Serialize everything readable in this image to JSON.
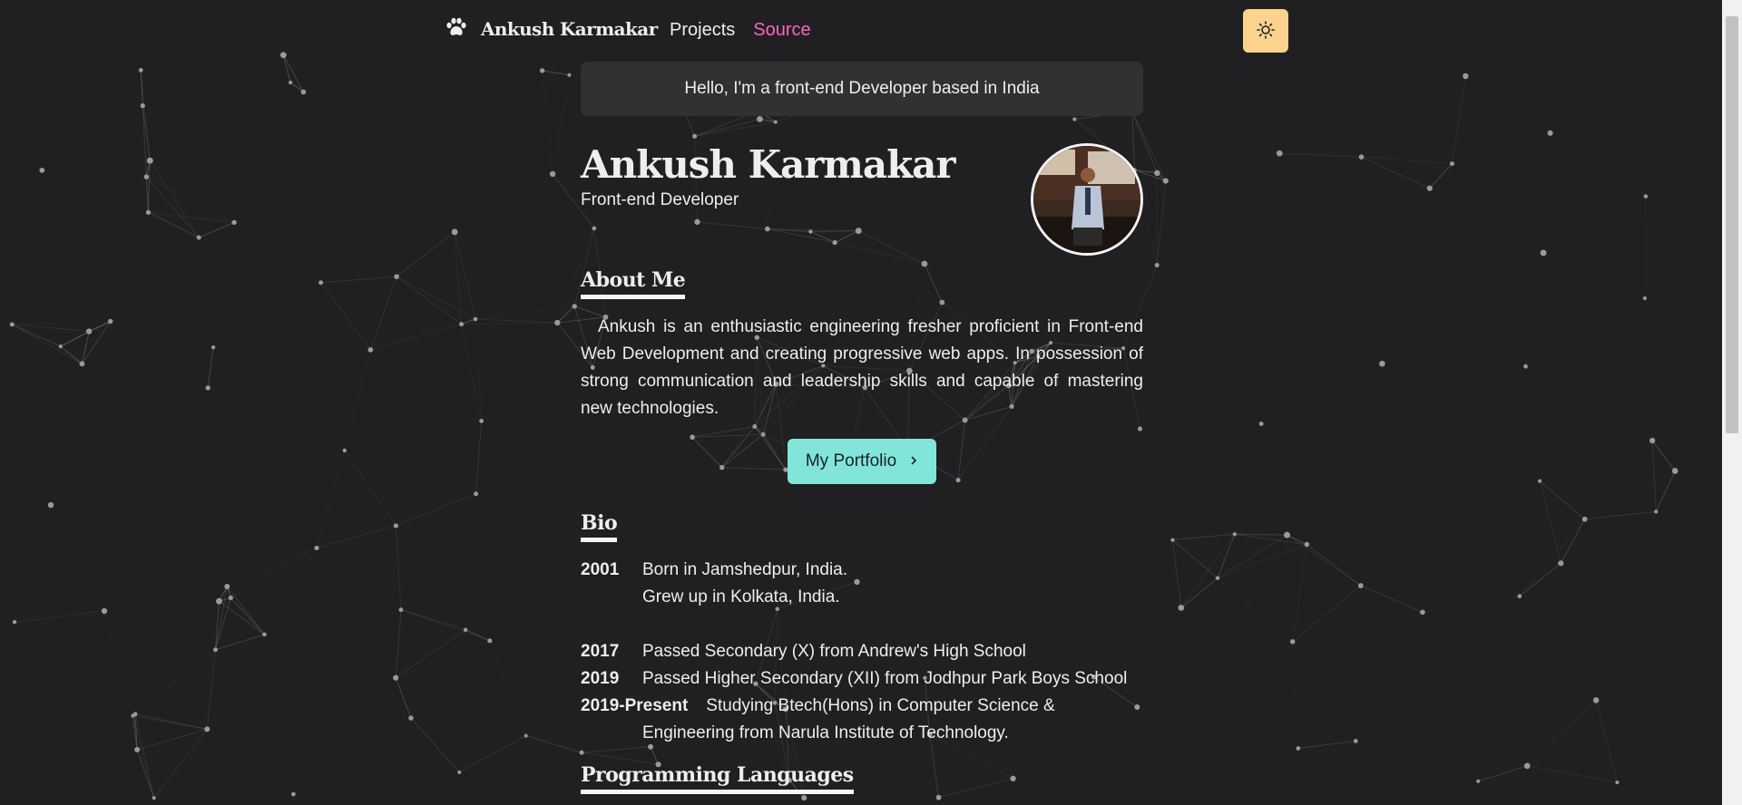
{
  "navbar": {
    "brand": "Ankush Karmakar",
    "brand_icon": "paw-icon",
    "links": [
      {
        "label": "Projects",
        "active": false
      },
      {
        "label": "Source",
        "active": true
      }
    ],
    "theme_toggle_icon": "sun-icon",
    "colors": {
      "accent_link": "#ff63c3",
      "theme_button": "#fbd38d"
    }
  },
  "hello_banner": "Hello, I'm a front-end Developer based in India",
  "hero": {
    "name": "Ankush Karmakar",
    "title": "Front-end Developer"
  },
  "about": {
    "heading": "About Me",
    "text": "Ankush is an enthusiastic engineering fresher proficient in Front-end Web Development and creating progressive web apps. In possession of strong communication and leadership skills and capable of mastering new technologies.",
    "button_label": "My Portfolio",
    "button_icon": "chevron-right-icon",
    "button_color": "#81e6d9"
  },
  "bio": {
    "heading": "Bio",
    "entries": [
      {
        "year": "2001",
        "lines": [
          "Born in Jamshedpur, India.",
          "Grew up in Kolkata, India."
        ]
      },
      {
        "year": "2017",
        "lines": [
          "Passed Secondary (X) from Andrew's High School"
        ]
      },
      {
        "year": "2019",
        "lines": [
          "Passed Higher Secondary (XII) from Jodhpur Park Boys School"
        ]
      },
      {
        "year": "2019-Present",
        "lines": [
          "Studying Btech(Hons) in Computer Science &",
          "Engineering from Narula Institute of Technology."
        ]
      }
    ]
  },
  "programming": {
    "heading": "Programming Languages"
  }
}
